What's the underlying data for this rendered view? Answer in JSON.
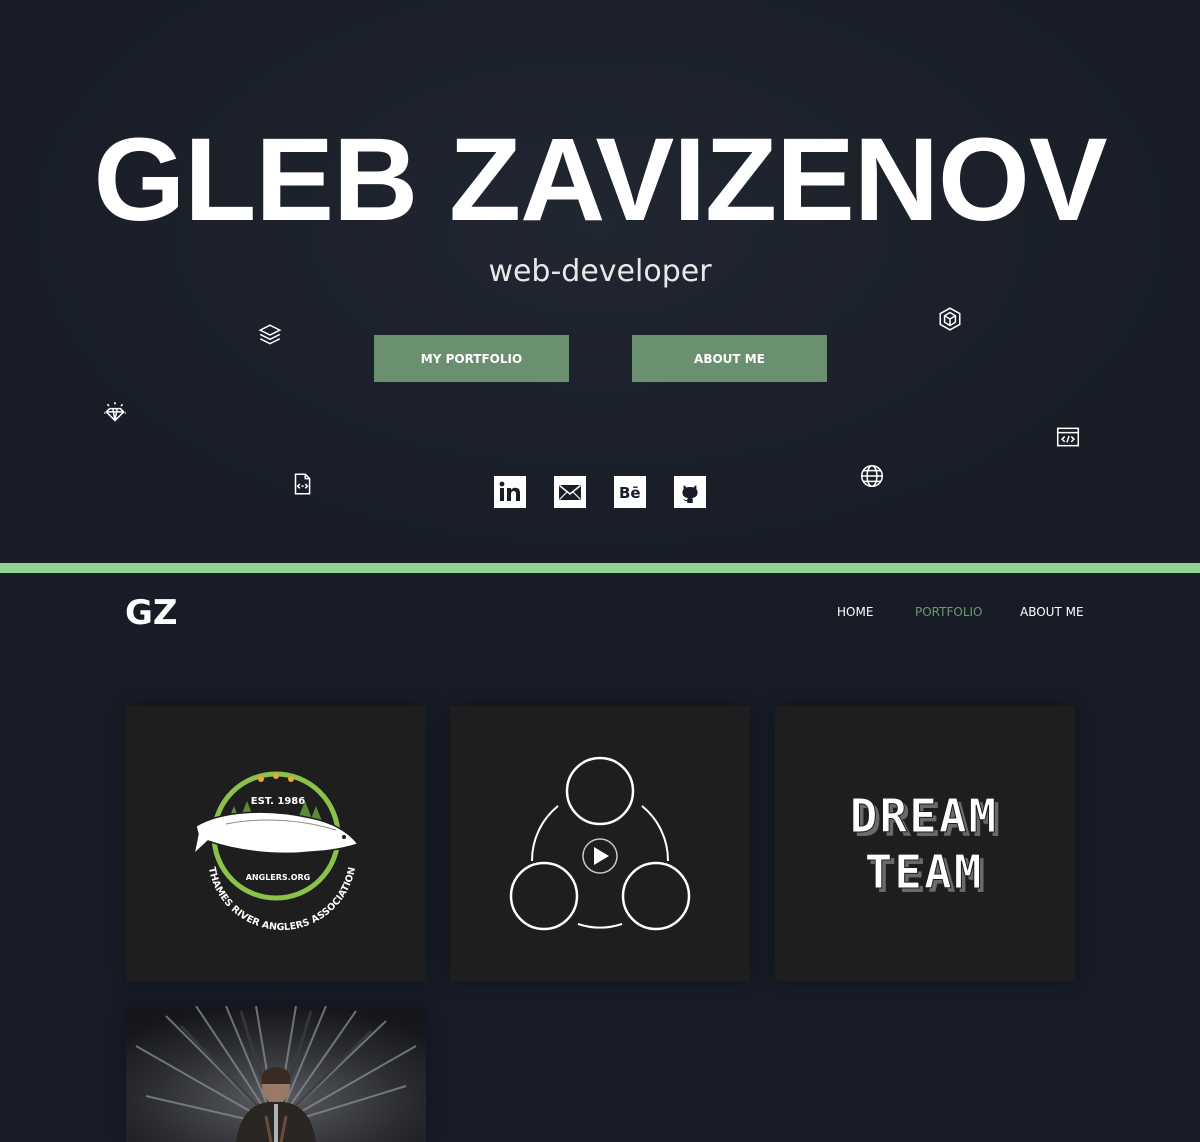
{
  "hero": {
    "title": "GLEB ZAVIZENOV",
    "subtitle": "web-developer",
    "buttons": {
      "portfolio": "MY PORTFOLIO",
      "about": "ABOUT ME"
    }
  },
  "nav": {
    "logo": "GZ",
    "items": [
      {
        "label": "HOME",
        "active": false
      },
      {
        "label": "PORTFOLIO",
        "active": true
      },
      {
        "label": "ABOUT ME",
        "active": false
      }
    ]
  },
  "portfolio": {
    "cards": [
      {
        "name": "thames-river-anglers",
        "text_top": "EST. 1986",
        "text_mid": "ANGLERS.ORG",
        "text_ring": "THAMES RIVER ANGLERS ASSOCIATION"
      },
      {
        "name": "video-circles"
      },
      {
        "name": "dream-team",
        "line1": "DREAM",
        "line2": "TEAM"
      },
      {
        "name": "throne-photo"
      }
    ]
  },
  "social": [
    "linkedin-icon",
    "email-icon",
    "behance-icon",
    "github-icon"
  ],
  "colors": {
    "accent": "#6a9070",
    "divider": "#8fd494",
    "active_nav": "#6a9a6e",
    "background": "#171c27"
  }
}
